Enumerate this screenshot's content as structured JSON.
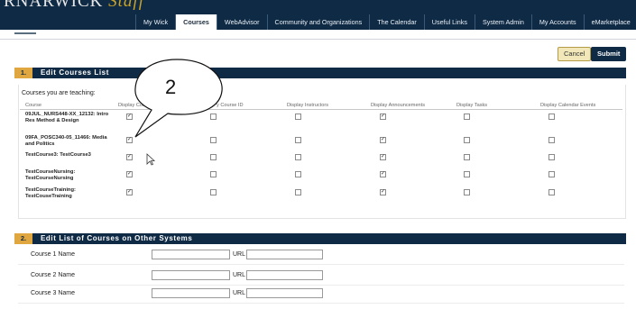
{
  "header": {
    "brand": "RNARWICK",
    "brand_suffix": "Staff",
    "tabs": [
      "My Wick",
      "Courses",
      "WebAdvisor",
      "Community and Organizations",
      "The Calendar",
      "Useful Links",
      "System Admin",
      "My Accounts",
      "eMarketplace"
    ],
    "active_tab": "Courses"
  },
  "actions": {
    "cancel_label": "Cancel",
    "submit_label": "Submit"
  },
  "section1": {
    "number": "1.",
    "title": "Edit Courses List",
    "teaching_label": "Courses you are teaching:",
    "columns": [
      "Course",
      "Display Cou",
      "y Course ID",
      "Display Instructors",
      "Display Announcements",
      "Display Tasks",
      "Display Calendar Events"
    ],
    "rows": [
      {
        "name": "09JUL_NURS448-XX_12132: Intro Res Method & Design",
        "checks": [
          true,
          false,
          false,
          true,
          false,
          false
        ]
      },
      {
        "name": "09FA_POSC340-05_11466: Media and Politics",
        "checks": [
          true,
          false,
          false,
          true,
          false,
          false
        ]
      },
      {
        "name": "TestCourse3: TestCourse3",
        "checks": [
          true,
          false,
          false,
          true,
          false,
          false
        ]
      },
      {
        "name": "TestCourseNursing: TestCourseNursing",
        "checks": [
          true,
          false,
          false,
          true,
          false,
          false
        ]
      },
      {
        "name": "TestCourseTraining: TestCouseTraining",
        "checks": [
          true,
          false,
          false,
          true,
          false,
          false
        ]
      }
    ]
  },
  "section2": {
    "number": "2.",
    "title": "Edit List of Courses on Other Systems",
    "url_label": "URL",
    "rows": [
      {
        "label": "Course 1 Name",
        "name_value": "",
        "url_value": ""
      },
      {
        "label": "Course 2 Name",
        "name_value": "",
        "url_value": ""
      },
      {
        "label": "Course 3 Name",
        "name_value": "",
        "url_value": ""
      }
    ]
  },
  "callout": {
    "label": "2"
  },
  "colors": {
    "navy": "#0f2a45",
    "gold": "#e0a640",
    "cancel_bg": "#f1e7b8"
  }
}
